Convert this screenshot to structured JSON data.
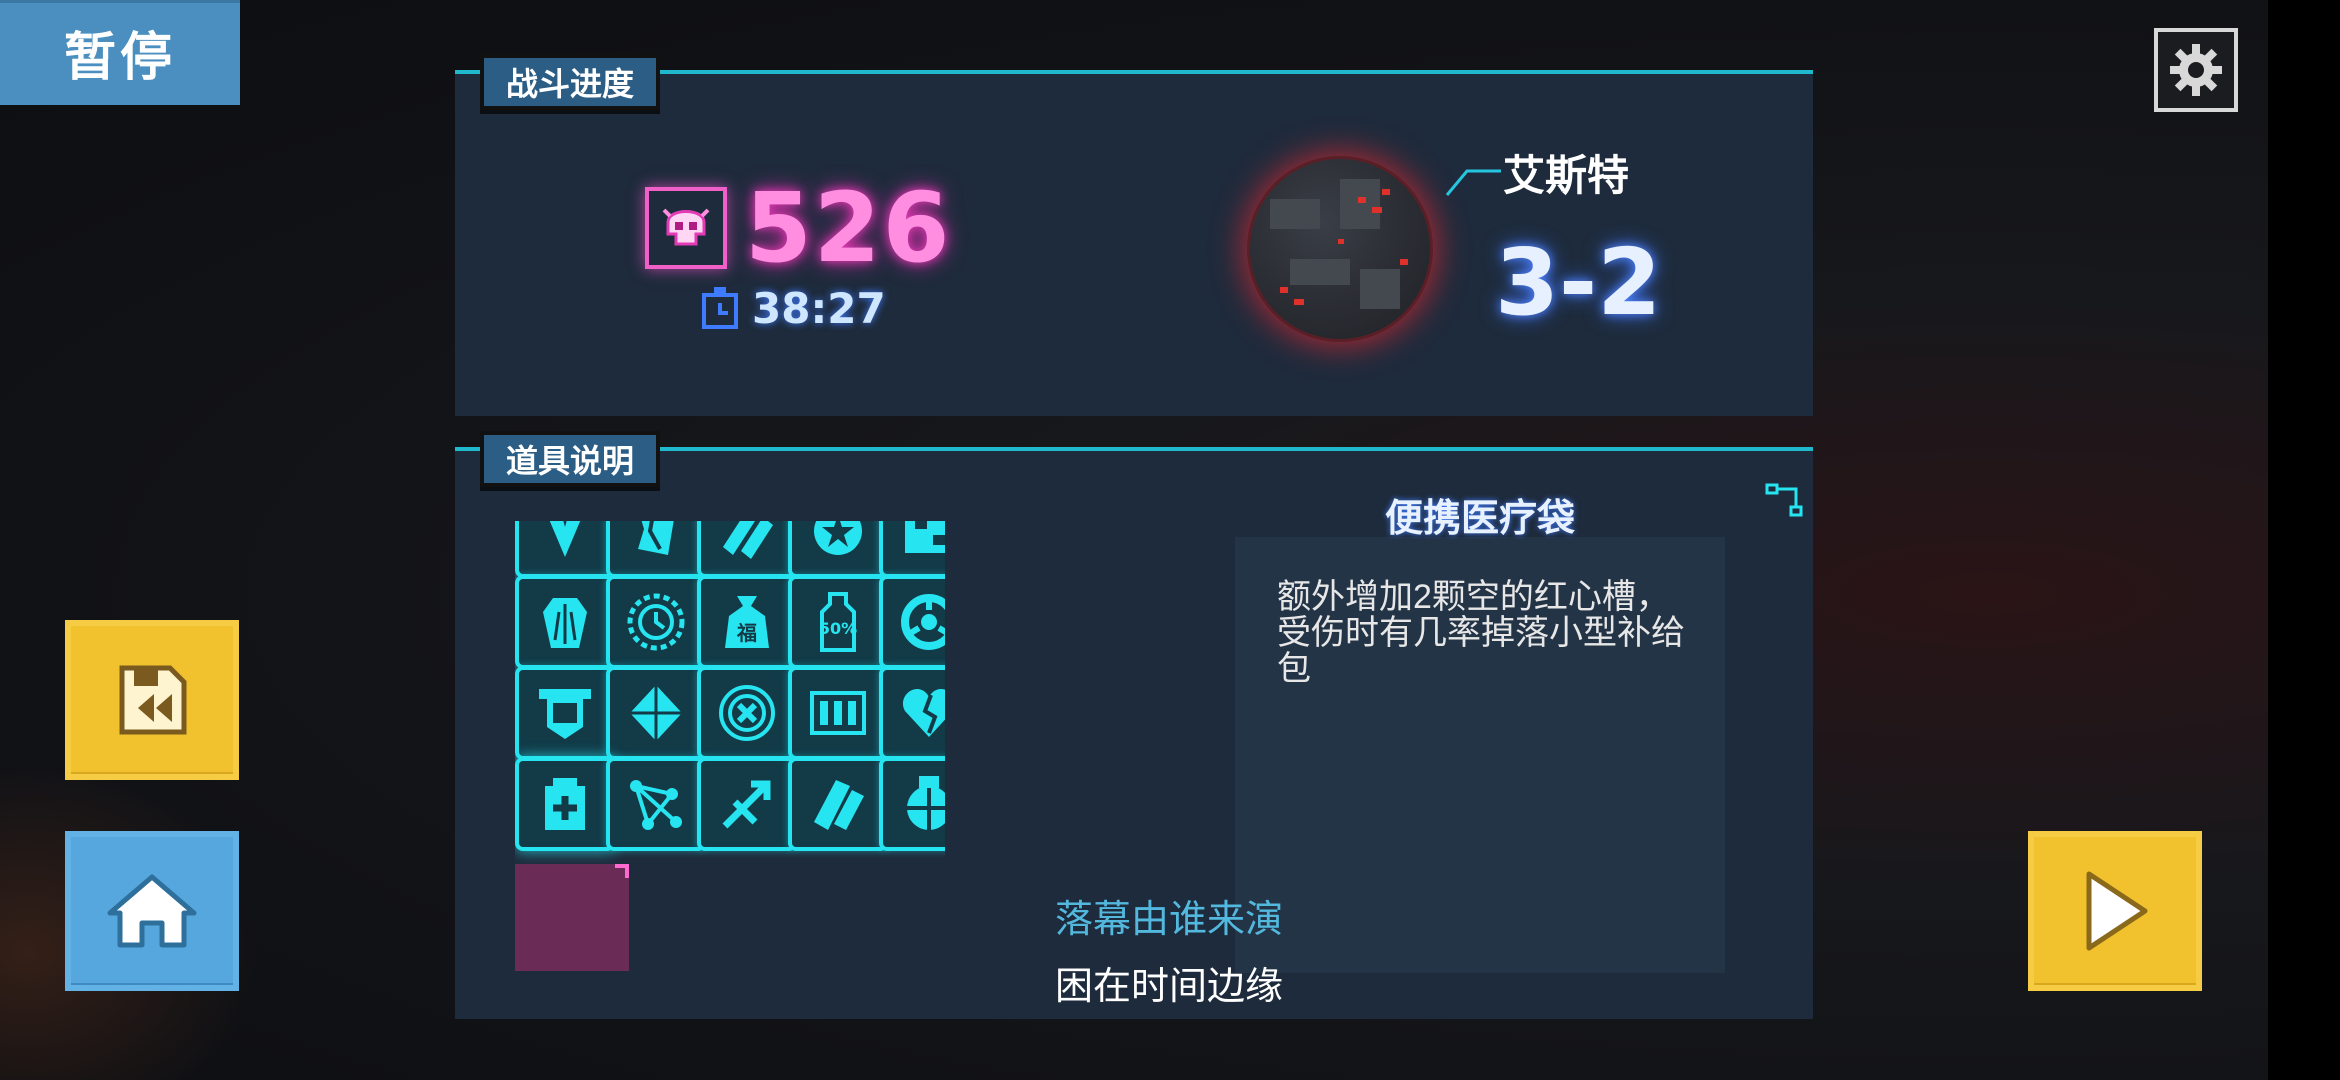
{
  "pause": {
    "label": "暂停"
  },
  "battle_progress": {
    "section_label": "战斗进度",
    "kills": "526",
    "time": "38:27",
    "location": "艾斯特",
    "stage": "3-2"
  },
  "items_panel": {
    "section_label": "道具说明",
    "items": [
      {
        "icon": "arrow-down-icon"
      },
      {
        "icon": "shield-break-icon"
      },
      {
        "icon": "double-bullet-icon"
      },
      {
        "icon": "star-badge-icon"
      },
      {
        "icon": "pixel-mask-icon"
      },
      {
        "icon": "crystal-icon"
      },
      {
        "icon": "clock-gear-icon"
      },
      {
        "icon": "fortune-bag-icon",
        "text": "福"
      },
      {
        "icon": "discount-bottle-icon",
        "text": "50%"
      },
      {
        "icon": "target-ring-icon"
      },
      {
        "icon": "pocket-icon"
      },
      {
        "icon": "diamond-icon"
      },
      {
        "icon": "cancel-circle-icon"
      },
      {
        "icon": "bullets-icon"
      },
      {
        "icon": "broken-heart-icon"
      },
      {
        "icon": "medkit-icon"
      },
      {
        "icon": "network-icon"
      },
      {
        "icon": "arrows-icon"
      },
      {
        "icon": "cards-icon"
      },
      {
        "icon": "globe-lock-icon"
      }
    ],
    "selected_index": 15,
    "selected": {
      "name": "便携医疗袋",
      "description": "额外增加2颗空的红心槽，受伤时有几率掉落小型补给包"
    }
  },
  "lyrics": {
    "line1": "落幕由谁来演",
    "line2": "困在时间边缘"
  },
  "colors": {
    "neon_cyan": "#26e4f0",
    "kill_pink": "#ff8ee0",
    "panel_bg": "#1e2b3c",
    "button_yellow": "#f2c12e",
    "button_blue": "#55a7de"
  }
}
